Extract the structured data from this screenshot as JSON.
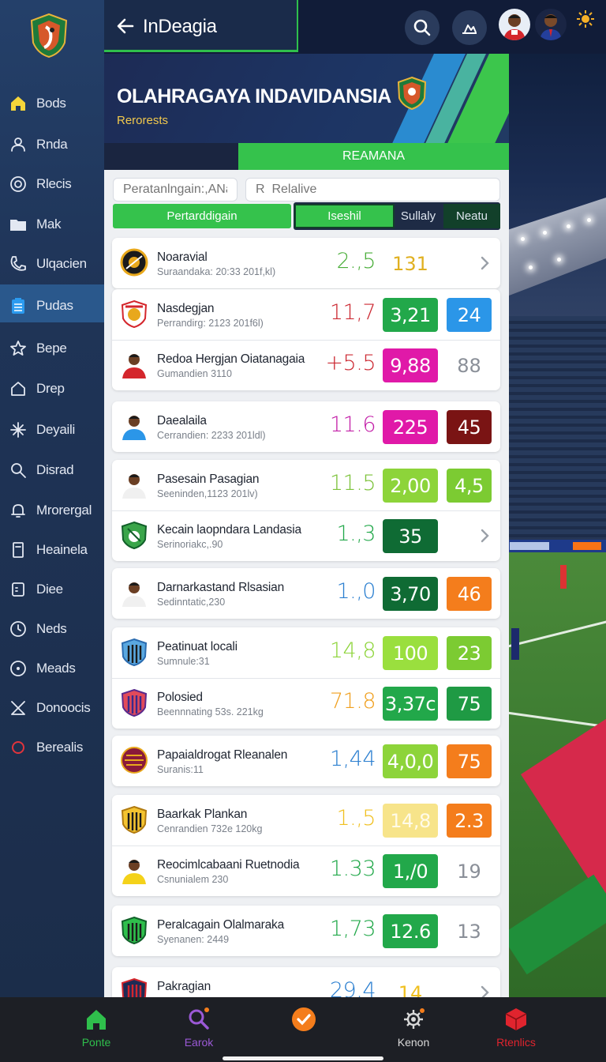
{
  "app": {
    "title": "InDeagia"
  },
  "sidebar": {
    "items": [
      {
        "label": "Bods",
        "icon": "home-icon"
      },
      {
        "label": "Rnda",
        "icon": "user-group-icon"
      },
      {
        "label": "Rlecis",
        "icon": "target-icon"
      },
      {
        "label": "Mak",
        "icon": "folder-icon"
      },
      {
        "label": "Ulqacien",
        "icon": "phone-icon"
      },
      {
        "label": "Pudas",
        "icon": "clipboard-icon"
      },
      {
        "label": "Bepe",
        "icon": "star-icon"
      },
      {
        "label": "Drep",
        "icon": "house-outline-icon"
      },
      {
        "label": "Deyaili",
        "icon": "sparkle-icon"
      },
      {
        "label": "Disrad",
        "icon": "search-icon"
      },
      {
        "label": "Mrorergal",
        "icon": "bell-icon"
      },
      {
        "label": "Heainela",
        "icon": "document-icon"
      },
      {
        "label": "Diee",
        "icon": "card-icon"
      },
      {
        "label": "Neds",
        "icon": "clock-icon"
      },
      {
        "label": "Meads",
        "icon": "record-icon"
      },
      {
        "label": "Donoocis",
        "icon": "x-icon"
      },
      {
        "label": "Berealis",
        "icon": "circle-red-icon"
      }
    ]
  },
  "banner": {
    "title": "OLAHRAGAYA INDAVIDANSIA",
    "subtitle": "Rerorests",
    "section_tab": "REAMANA"
  },
  "filters": {
    "search_placeholder": "Peratanlngain:,ANa",
    "relative_placeholder": "R  Relalive"
  },
  "segments": [
    {
      "label": "Pertarddigain",
      "state": "active"
    },
    {
      "label": "Iseshil",
      "state": "selected"
    },
    {
      "label": "Sullaly",
      "state": "dark"
    },
    {
      "label": "Neatu",
      "state": "dark"
    }
  ],
  "colors": {
    "green": "#35c24c",
    "dark_green": "#0f6b34",
    "mid_green": "#22a84a",
    "lime": "#8dd43a",
    "magenta": "#e019a8",
    "blue": "#2b96e8",
    "orange": "#f47d1c",
    "maroon": "#7a1414",
    "pale_yellow": "#f7e48a",
    "red": "#d0303a"
  },
  "cards": [
    {
      "rows": [
        {
          "name": "Noaravial",
          "sub": "Suraandaka: 20:33 201f,kl)",
          "logo": "crest-black-gold-icon",
          "v1": "2.,5",
          "v1_color": "#4aae3a",
          "b1": "131",
          "b1_style": "text",
          "b1_color": "#e0b020",
          "b2": "",
          "b2_style": "chevron"
        }
      ]
    },
    {
      "rows": [
        {
          "name": "Nasdegjan",
          "sub": "Perrandirg: 2123  201f6l)",
          "logo": "crest-orange-white-icon",
          "v1": "11,7",
          "v1_color": "#cc2a33",
          "b1": "3,21",
          "b1_style": "box",
          "b1_color": "#22a84a",
          "b2": "24",
          "b2_style": "box",
          "b2_color": "#2b96e8"
        },
        {
          "name": "Redoa Hergjan Oiatanagaia",
          "sub": "Gumandien 3110",
          "logo": "player-red-icon",
          "v1": "+5.5",
          "v1_color": "#cc2a33",
          "b1": "9,88",
          "b1_style": "box",
          "b1_color": "#e019a8",
          "b2": "88",
          "b2_style": "text",
          "b2_color": "#8a8f98"
        }
      ]
    },
    {
      "rows": [
        {
          "name": "Daealaila",
          "sub": "Cerrandien: 2233  201ldl)",
          "logo": "player-blue-icon",
          "v1": "11.6",
          "v1_color": "#c31fa8",
          "b1": "225",
          "b1_style": "box",
          "b1_color": "#e019a8",
          "b2": "45",
          "b2_style": "box",
          "b2_color": "#7a1414"
        }
      ]
    },
    {
      "rows": [
        {
          "name": "Pasesain Pasagian",
          "sub": "Seeninden,1123  201lv)",
          "logo": "player-white-icon",
          "v1": "11.5",
          "v1_color": "#7cc23a",
          "b1": "2,00",
          "b1_style": "box",
          "b1_color": "#8dd43a",
          "b2": "4,5",
          "b2_style": "box",
          "b2_color": "#7ccb32"
        },
        {
          "name": "Kecain laopndara Landasia",
          "sub": "Serinoriakc,.90",
          "logo": "crest-green-icon",
          "v1": "1.,3",
          "v1_color": "#22a84a",
          "b1": "35",
          "b1_style": "box",
          "b1_color": "#0f6b34",
          "b2": "",
          "b2_style": "chevron"
        }
      ]
    },
    {
      "rows": [
        {
          "name": "Darnarkastand Rlsasian",
          "sub": "Sedinntatic,230",
          "logo": "player-white-icon",
          "v1": "1.,0",
          "v1_color": "#2b7fd0",
          "b1": "3,70",
          "b1_style": "box",
          "b1_color": "#0f6b34",
          "b2": "46",
          "b2_style": "box",
          "b2_color": "#f47d1c"
        }
      ]
    },
    {
      "rows": [
        {
          "name": "Peatinuat locali",
          "sub": "Sumnule:31",
          "logo": "crest-blue-stripe-icon",
          "v1": "14,8",
          "v1_color": "#8dd43a",
          "b1": "100",
          "b1_style": "box",
          "b1_color": "#9adf3e",
          "b2": "23",
          "b2_style": "box",
          "b2_color": "#7ccb32"
        },
        {
          "name": "Polosied",
          "sub": "Beennnating 53s. 221kg",
          "logo": "crest-purple-stripe-icon",
          "v1": "71.8",
          "v1_color": "#f0a020",
          "b1": "3,37c",
          "b1_style": "box",
          "b1_color": "#22a84a",
          "b2": "75",
          "b2_style": "box",
          "b2_color": "#1f9a44"
        }
      ]
    },
    {
      "rows": [
        {
          "name": "Papaialdrogat Rleanalen",
          "sub": "Suranis:11",
          "logo": "crest-maroon-round-icon",
          "v1": "1,44",
          "v1_color": "#2b7fd0",
          "b1": "4,0,0",
          "b1_style": "box",
          "b1_color": "#8dd43a",
          "b2": "75",
          "b2_style": "box",
          "b2_color": "#f47d1c"
        }
      ]
    },
    {
      "rows": [
        {
          "name": "Baarkak Plankan",
          "sub": "Cenrandien 732e  120kg",
          "logo": "crest-gold-stripe-icon",
          "v1": "1.,5",
          "v1_color": "#f0c020",
          "b1": "14,8",
          "b1_style": "box",
          "b1_color": "#f7e48a",
          "b2": "2.3",
          "b2_style": "box",
          "b2_color": "#f47d1c"
        },
        {
          "name": "Reocimlcabaani Ruetnodia",
          "sub": "Csnunialem 230",
          "logo": "player-yellow-icon",
          "v1": "1.33",
          "v1_color": "#22a84a",
          "b1": "1,/0",
          "b1_style": "box",
          "b1_color": "#22a84a",
          "b2": "19",
          "b2_style": "text",
          "b2_color": "#8a8f98"
        }
      ]
    },
    {
      "rows": [
        {
          "name": "Peralcagain Olalmaraka",
          "sub": "Syenanen: 2449",
          "logo": "crest-green-stripe-icon",
          "v1": "1,73",
          "v1_color": "#22a84a",
          "b1": "12.6",
          "b1_style": "box",
          "b1_color": "#22a84a",
          "b2": "13",
          "b2_style": "text",
          "b2_color": "#8a8f98"
        }
      ]
    },
    {
      "rows": [
        {
          "name": "Pakragian",
          "sub": "",
          "logo": "crest-navy-stripe-icon",
          "v1": "29.4",
          "v1_color": "#2b7fd0",
          "b1": "14",
          "b1_style": "text",
          "b1_color": "#f0c020",
          "b2": "",
          "b2_style": "chevron"
        }
      ]
    }
  ],
  "bottom_nav": [
    {
      "label": "Ponte",
      "icon": "home-icon",
      "color": "#2fbf4c"
    },
    {
      "label": "Earok",
      "icon": "search-icon",
      "color": "#9b59d6"
    },
    {
      "label": "",
      "icon": "check-circle-icon",
      "color": "#f47d1c"
    },
    {
      "label": "Kenon",
      "icon": "gear-icon",
      "color": "#d9d9d9"
    },
    {
      "label": "Rtenlics",
      "icon": "cube-icon",
      "color": "#e0242e"
    }
  ]
}
